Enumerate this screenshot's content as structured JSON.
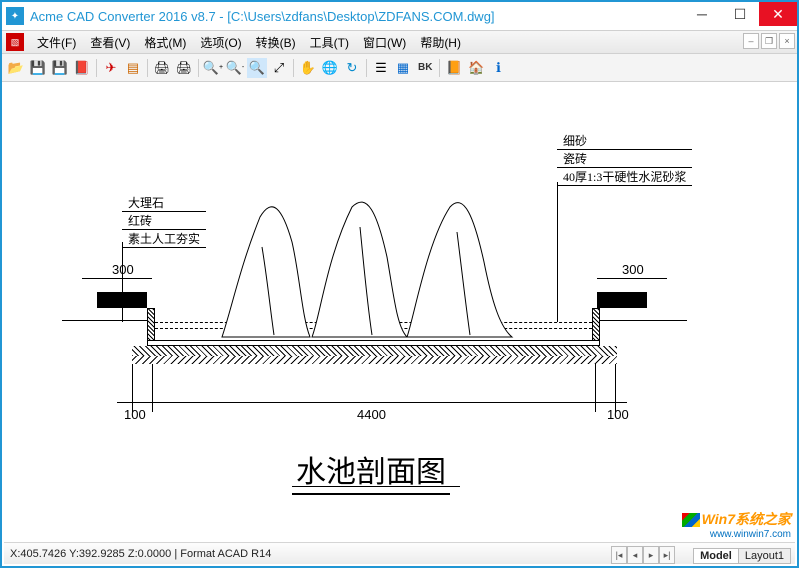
{
  "titlebar": {
    "text": "Acme CAD Converter 2016 v8.7 - [C:\\Users\\zdfans\\Desktop\\ZDFANS.COM.dwg]"
  },
  "menubar": {
    "items": [
      "文件(F)",
      "查看(V)",
      "格式(M)",
      "选项(O)",
      "转换(B)",
      "工具(T)",
      "窗口(W)",
      "帮助(H)"
    ]
  },
  "toolbar": {
    "bk_label": "BK"
  },
  "drawing": {
    "labels_left": [
      "大理石",
      "红砖",
      "素土人工夯实"
    ],
    "labels_right": [
      "细砂",
      "瓷砖",
      "40厚1:3干硬性水泥砂浆"
    ],
    "dims": {
      "left300": "300",
      "right300": "300",
      "left100": "100",
      "mid4400": "4400",
      "right100": "100"
    },
    "title": "水池剖面图"
  },
  "statusbar": {
    "text": "X:405.7426 Y:392.9285 Z:0.0000 | Format ACAD R14"
  },
  "tabs": {
    "model": "Model",
    "layout": "Layout1"
  },
  "watermark": {
    "main": "Win7系统之家",
    "sub": "www.winwin7.com"
  }
}
